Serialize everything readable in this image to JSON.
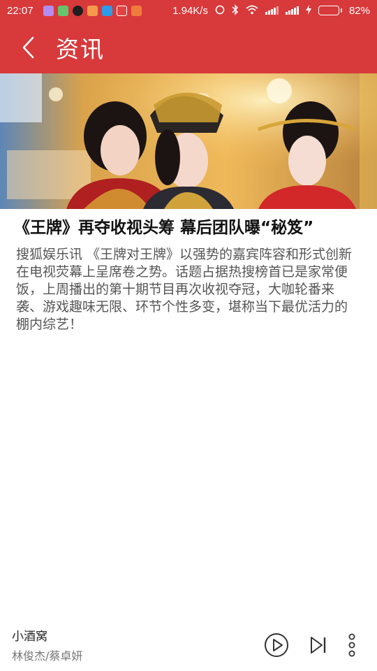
{
  "status_bar": {
    "time": "22:07",
    "net_speed": "1.94K/s",
    "battery_percent": "82%",
    "battery_level": 0.82,
    "notification_icons": [
      "gallery-app-icon",
      "clipboard-app-icon",
      "qq-icon",
      "mail-app-icon",
      "weibo-icon",
      "alarm-app-icon",
      "video-app-icon"
    ]
  },
  "app_bar": {
    "title": "资讯",
    "back_icon": "chevron-left-icon"
  },
  "article": {
    "headline": "《王牌》再夺收视头筹 幕后团队曝“秘笈”",
    "body": "搜狐娱乐讯 《王牌对王牌》以强势的嘉宾阵容和形式创新在电视荧幕上呈席卷之势。话题占据热搜榜首已是家常便饭，上周播出的第十期节目再次收视夺冠，大咖轮番来袭、游戏趣味无限、环节个性多变，堪称当下最优活力的棚内综艺！"
  },
  "player": {
    "song_title": "小酒窝",
    "artist": "林俊杰/蔡卓妍",
    "controls": [
      "play-icon",
      "next-track-icon",
      "more-icon"
    ]
  },
  "colors": {
    "brand": "#d8393b",
    "headline": "#111111",
    "body_text": "#555555"
  }
}
